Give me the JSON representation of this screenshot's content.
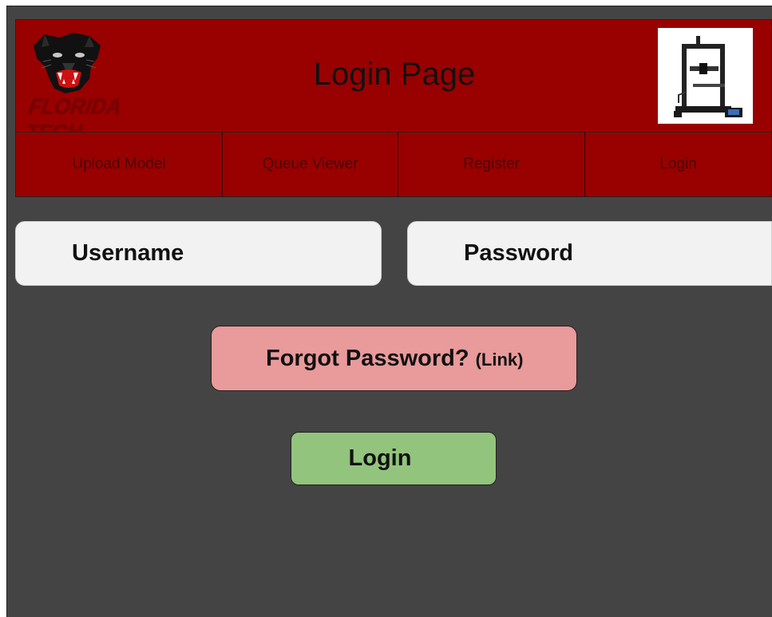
{
  "header": {
    "title": "Login Page",
    "logo_text": "FLORIDA TECH",
    "logo_icon": "panther-head-icon",
    "printer_icon": "3d-printer-icon"
  },
  "nav": {
    "items": [
      {
        "label": "Upload Model"
      },
      {
        "label": "Queue Viewer"
      },
      {
        "label": "Register"
      },
      {
        "label": "Login"
      }
    ]
  },
  "form": {
    "username_placeholder": "Username",
    "password_placeholder": "Password",
    "forgot_label": "Forgot Password?",
    "forgot_link_note": "(Link)",
    "login_label": "Login"
  },
  "colors": {
    "header_bg": "#990000",
    "page_bg": "#444444",
    "forgot_bg": "#e99a9a",
    "login_bg": "#93c47d",
    "field_bg": "#f2f2f2"
  }
}
